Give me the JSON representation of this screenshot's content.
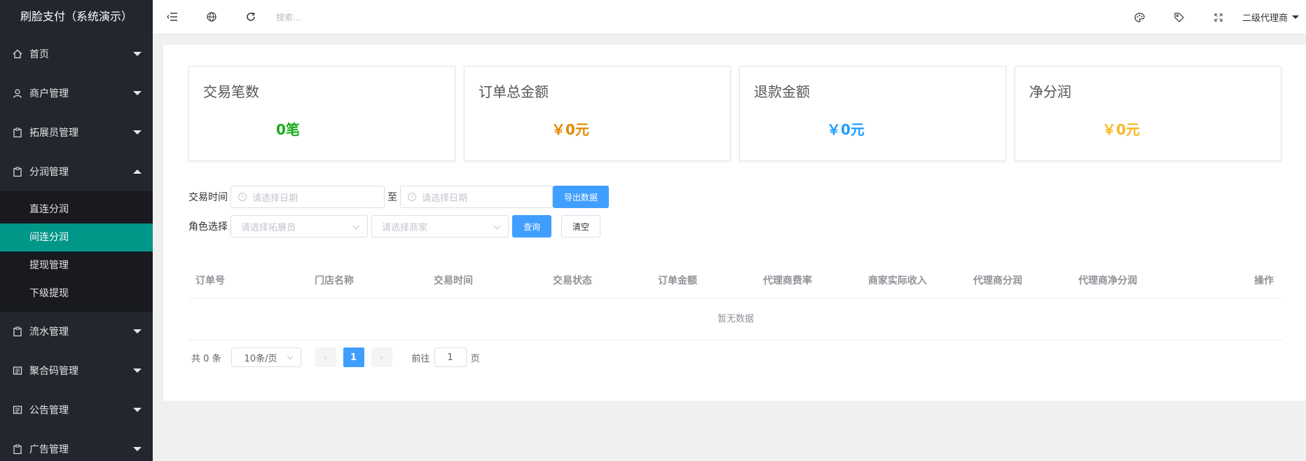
{
  "app": {
    "title": "刷脸支付（系统演示）"
  },
  "sidebar": {
    "items": [
      {
        "label": "首页",
        "icon": "home-icon",
        "expanded": false
      },
      {
        "label": "商户管理",
        "icon": "user-icon",
        "expanded": false
      },
      {
        "label": "拓展员管理",
        "icon": "clipboard-icon",
        "expanded": false
      },
      {
        "label": "分润管理",
        "icon": "clipboard-icon",
        "expanded": true,
        "children": [
          {
            "label": "直连分润",
            "active": false
          },
          {
            "label": "间连分润",
            "active": true
          },
          {
            "label": "提现管理",
            "active": false
          },
          {
            "label": "下级提现",
            "active": false
          }
        ]
      },
      {
        "label": "流水管理",
        "icon": "clipboard-icon",
        "expanded": false
      },
      {
        "label": "聚合码管理",
        "icon": "list-icon",
        "expanded": false
      },
      {
        "label": "公告管理",
        "icon": "list-icon",
        "expanded": false
      },
      {
        "label": "广告管理",
        "icon": "clipboard-icon",
        "expanded": false
      }
    ]
  },
  "topbar": {
    "search_placeholder": "搜索...",
    "user_name": "二级代理商"
  },
  "stats": [
    {
      "title": "交易笔数",
      "value": "0笔",
      "color": "#1aaa1a"
    },
    {
      "title": "订单总金额",
      "value": "￥0元",
      "color": "#e08a00"
    },
    {
      "title": "退款金额",
      "value": "￥0元",
      "color": "#1e9fff"
    },
    {
      "title": "净分润",
      "value": "￥0元",
      "color": "#f7b824"
    }
  ],
  "filters": {
    "time_label": "交易时间",
    "date_placeholder": "请选择日期",
    "to_label": "至",
    "export_label": "导出数据",
    "role_label": "角色选择",
    "expander_placeholder": "请选择拓展员",
    "merchant_placeholder": "请选择商家",
    "query_label": "查询",
    "clear_label": "清空"
  },
  "table": {
    "columns": [
      "订单号",
      "门店名称",
      "交易时间",
      "交易状态",
      "订单金额",
      "代理商费率",
      "商家实际收入",
      "代理商分润",
      "代理商净分润",
      "操作"
    ],
    "empty_text": "暂无数据"
  },
  "pagination": {
    "total_text": "共 0 条",
    "page_size": "10条/页",
    "current_page": "1",
    "goto_label": "前往",
    "goto_value": "1",
    "page_unit": "页"
  }
}
